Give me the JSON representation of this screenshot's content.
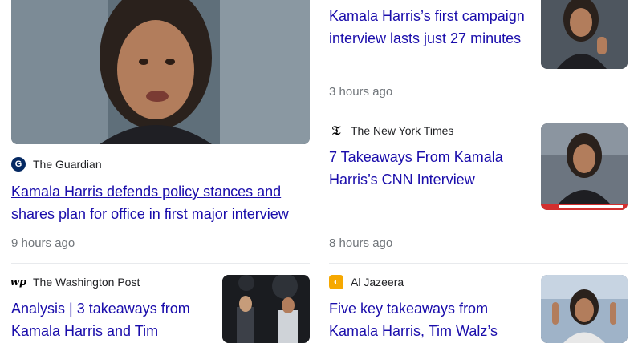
{
  "cards": [
    {
      "source": "The Guardian",
      "source_icon": "guardian-logo-icon",
      "headline": "Kamala Harris defends policy stances and shares plan for office in first major interview",
      "time": "9 hours ago"
    },
    {
      "source": "",
      "headline": "Kamala Harris’s first campaign interview lasts just 27 minutes",
      "time": "3 hours ago"
    },
    {
      "source": "The New York Times",
      "source_icon": "nyt-logo-icon",
      "headline": "7 Takeaways From Kamala Harris’s CNN Interview",
      "time": "8 hours ago"
    },
    {
      "source": "The Washington Post",
      "source_icon": "wapo-logo-icon",
      "headline": "Analysis | 3 takeaways from Kamala Harris and Tim",
      "time": ""
    },
    {
      "source": "Al Jazeera",
      "source_icon": "aljazeera-logo-icon",
      "headline": "Five key takeaways from Kamala Harris, Tim Walz’s",
      "time": ""
    }
  ],
  "colors": {
    "link": "#1a0dab",
    "meta": "#70757a",
    "divider": "#e8eaed",
    "aljazeera": "#f6a800",
    "guardian": "#052962"
  }
}
